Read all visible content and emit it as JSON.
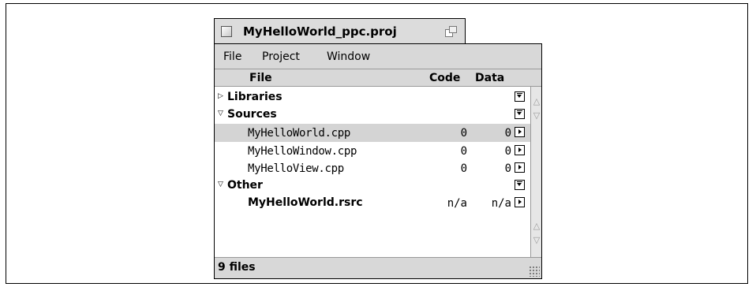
{
  "window": {
    "title": "MyHelloWorld_ppc.proj"
  },
  "menu": [
    "File",
    "Project",
    "Window"
  ],
  "columns": {
    "file": "File",
    "code": "Code",
    "data": "Data"
  },
  "rows": [
    {
      "name": "Libraries",
      "kind": "group",
      "expanded": false
    },
    {
      "name": "Sources",
      "kind": "group",
      "expanded": true
    },
    {
      "name": "MyHelloWorld.cpp",
      "kind": "file",
      "code": "0",
      "data": "0",
      "selected": true
    },
    {
      "name": "MyHelloWindow.cpp",
      "kind": "file",
      "code": "0",
      "data": "0"
    },
    {
      "name": "MyHelloView.cpp",
      "kind": "file",
      "code": "0",
      "data": "0"
    },
    {
      "name": "Other",
      "kind": "group",
      "expanded": true
    },
    {
      "name": "MyHelloWorld.rsrc",
      "kind": "resource",
      "code": "n/a",
      "data": "n/a"
    }
  ],
  "status": {
    "text": "9 files"
  },
  "icons": {
    "close": "close-box-icon",
    "zoom": "zoom-box-icon",
    "collapsed": "disclosure-collapsed-icon",
    "expanded": "disclosure-expanded-icon",
    "group_popup": "popup-down-icon",
    "file_popup": "popup-right-icon",
    "grow": "grow-box-icon"
  }
}
